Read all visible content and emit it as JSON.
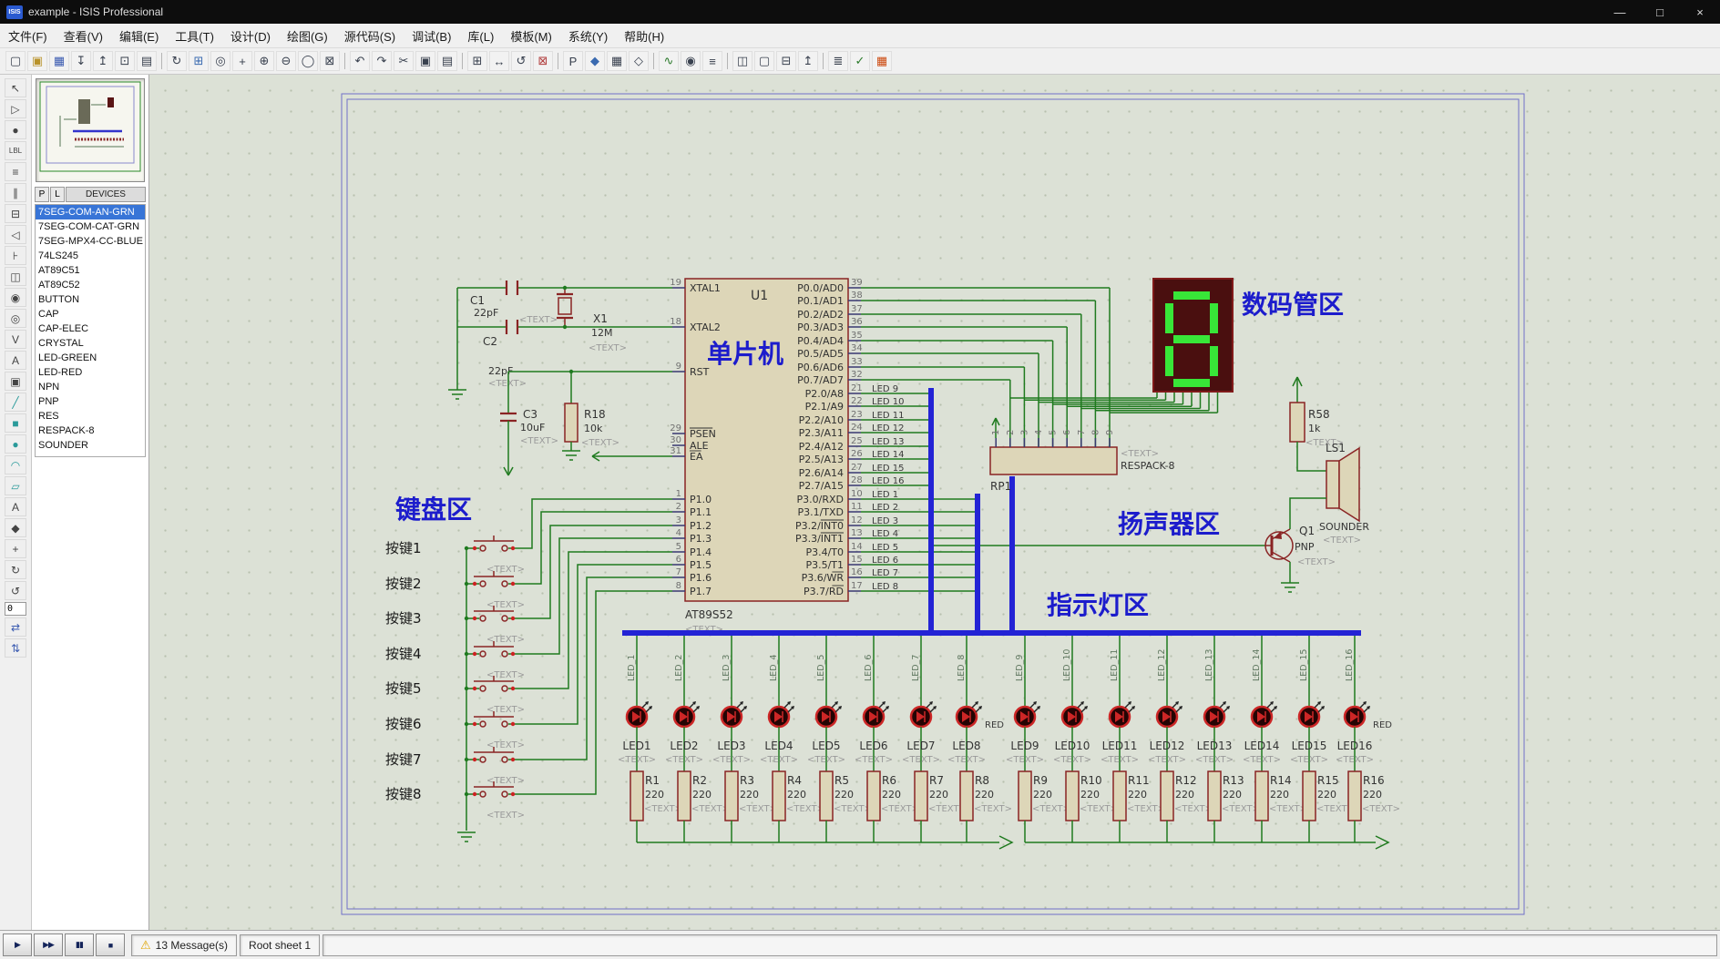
{
  "window": {
    "title": "example - ISIS Professional",
    "icon_text": "ISIS",
    "controls": {
      "minimize": "—",
      "maximize": "□",
      "close": "×"
    }
  },
  "menu_items": [
    "文件(F)",
    "查看(V)",
    "编辑(E)",
    "工具(T)",
    "设计(D)",
    "绘图(G)",
    "源代码(S)",
    "调试(B)",
    "库(L)",
    "模板(M)",
    "系统(Y)",
    "帮助(H)"
  ],
  "toolbar": [
    {
      "name": "new-file",
      "glyph": "▢"
    },
    {
      "name": "open-design",
      "glyph": "▣",
      "color": "#b8922a"
    },
    {
      "name": "save-design",
      "glyph": "▦",
      "color": "#3a5ab0"
    },
    {
      "name": "import-section",
      "glyph": "↧"
    },
    {
      "name": "export-section",
      "glyph": "↥"
    },
    {
      "name": "print-design",
      "glyph": "⊡"
    },
    {
      "name": "mark-output-area",
      "glyph": "▤"
    },
    {
      "name": "separator"
    },
    {
      "name": "redraw-display",
      "glyph": "↻"
    },
    {
      "name": "toggle-grid",
      "glyph": "⊞",
      "color": "#3a6ab0"
    },
    {
      "name": "false-origin",
      "glyph": "◎"
    },
    {
      "name": "center-at-cursor",
      "glyph": "+"
    },
    {
      "name": "zoom-in",
      "glyph": "⊕"
    },
    {
      "name": "zoom-out",
      "glyph": "⊖"
    },
    {
      "name": "zoom-all",
      "glyph": "◯"
    },
    {
      "name": "zoom-area",
      "glyph": "⊠"
    },
    {
      "name": "separator"
    },
    {
      "name": "undo",
      "glyph": "↶"
    },
    {
      "name": "redo",
      "glyph": "↷"
    },
    {
      "name": "cut",
      "glyph": "✂"
    },
    {
      "name": "copy",
      "glyph": "▣"
    },
    {
      "name": "paste",
      "glyph": "▤"
    },
    {
      "name": "separator"
    },
    {
      "name": "block-copy",
      "glyph": "⊞"
    },
    {
      "name": "block-move",
      "glyph": "↔"
    },
    {
      "name": "block-rotate",
      "glyph": "↺"
    },
    {
      "name": "block-delete",
      "glyph": "⊠",
      "color": "#b03a3a"
    },
    {
      "name": "separator"
    },
    {
      "name": "pick-device",
      "glyph": "P"
    },
    {
      "name": "make-device",
      "glyph": "◆",
      "color": "#3a6ab0"
    },
    {
      "name": "packaging-tool",
      "glyph": "▦"
    },
    {
      "name": "decompose",
      "glyph": "◇"
    },
    {
      "name": "separator"
    },
    {
      "name": "wire-autorouter",
      "glyph": "∿",
      "color": "#2a7a2a"
    },
    {
      "name": "search-tag",
      "glyph": "◉"
    },
    {
      "name": "property-assignment",
      "glyph": "≡"
    },
    {
      "name": "separator"
    },
    {
      "name": "design-explorer",
      "glyph": "◫"
    },
    {
      "name": "new-sheet",
      "glyph": "▢"
    },
    {
      "name": "remove-sheet",
      "glyph": "⊟"
    },
    {
      "name": "goto-sheet",
      "glyph": "↥"
    },
    {
      "name": "separator"
    },
    {
      "name": "bill-of-materials",
      "glyph": "≣"
    },
    {
      "name": "electrical-rule-check",
      "glyph": "✓",
      "color": "#2a7a2a"
    },
    {
      "name": "netlist-to-ares",
      "glyph": "▦",
      "color": "#cc4a10"
    }
  ],
  "left_tools": [
    {
      "name": "selection-pointer",
      "glyph": "↖"
    },
    {
      "name": "component-mode",
      "glyph": "▷"
    },
    {
      "name": "junction-dot-mode",
      "glyph": "●"
    },
    {
      "name": "wire-label-mode",
      "glyph": "LBL"
    },
    {
      "name": "text-script-mode",
      "glyph": "≡"
    },
    {
      "name": "buses-mode",
      "glyph": "∥"
    },
    {
      "name": "subcircuit-mode",
      "glyph": "⊟"
    },
    {
      "name": "terminals-mode",
      "glyph": "◁"
    },
    {
      "name": "device-pins-mode",
      "glyph": "⊦"
    },
    {
      "name": "graph-mode",
      "glyph": "◫"
    },
    {
      "name": "tape-recorder-mode",
      "glyph": "◉"
    },
    {
      "name": "generator-mode",
      "glyph": "◎"
    },
    {
      "name": "voltage-probe-mode",
      "glyph": "V"
    },
    {
      "name": "current-probe-mode",
      "glyph": "A"
    },
    {
      "name": "virtual-instruments-mode",
      "glyph": "▣"
    },
    {
      "name": "2d-line-mode",
      "glyph": "╱",
      "color": "#2a9a9a"
    },
    {
      "name": "2d-box-mode",
      "glyph": "■",
      "color": "#2a9a9a"
    },
    {
      "name": "2d-circle-mode",
      "glyph": "●",
      "color": "#2a9a9a"
    },
    {
      "name": "2d-arc-mode",
      "glyph": "◠",
      "color": "#2a9a9a"
    },
    {
      "name": "2d-path-mode",
      "glyph": "▱",
      "color": "#2a9a9a"
    },
    {
      "name": "2d-text-mode",
      "glyph": "A"
    },
    {
      "name": "2d-symbol-mode",
      "glyph": "◆"
    },
    {
      "name": "markers-mode",
      "glyph": "+"
    },
    {
      "name": "rotate-clockwise",
      "glyph": "↻"
    },
    {
      "name": "rotate-anticlockwise",
      "glyph": "↺"
    },
    {
      "name": "rotation-angle",
      "value": "0"
    },
    {
      "name": "mirror-horizontal",
      "glyph": "⇄",
      "color": "#3a5ab0"
    },
    {
      "name": "mirror-vertical",
      "glyph": "⇅",
      "color": "#3a5ab0"
    }
  ],
  "sidebar": {
    "tab_p": "P",
    "tab_l": "L",
    "header": "DEVICES",
    "selected": "7SEG-COM-AN-GRN",
    "devices": [
      "7SEG-COM-AN-GRN",
      "7SEG-COM-CAT-GRN",
      "7SEG-MPX4-CC-BLUE",
      "74LS245",
      "AT89C51",
      "AT89C52",
      "BUTTON",
      "CAP",
      "CAP-ELEC",
      "CRYSTAL",
      "LED-GREEN",
      "LED-RED",
      "NPN",
      "PNP",
      "RES",
      "RESPACK-8",
      "SOUNDER"
    ]
  },
  "statusbar": {
    "sim_buttons": [
      {
        "name": "play-button",
        "glyph": "▶"
      },
      {
        "name": "step-button",
        "glyph": "▶▶"
      },
      {
        "name": "pause-button",
        "glyph": "▮▮"
      },
      {
        "name": "stop-button",
        "glyph": "■"
      }
    ],
    "warning_icon": "⚠",
    "messages": "13 Message(s)",
    "sheet": "Root sheet 1"
  },
  "schematic": {
    "placeholder": "<TEXT>",
    "net_red": "RED",
    "seven_seg_digit": "8",
    "labels": {
      "mcu": "单片机",
      "display": "数码管区",
      "keyboard": "键盘区",
      "speaker": "扬声器区",
      "led": "指示灯区"
    },
    "mcu": {
      "ref": "U1",
      "part": "AT89S52",
      "left_pins": [
        {
          "num": "19",
          "name": "XTAL1"
        },
        {
          "num": "18",
          "name": "XTAL2"
        },
        {
          "num": "9",
          "name": "RST"
        },
        {
          "num": "29",
          "name": "PSEN",
          "bar": true
        },
        {
          "num": "30",
          "name": "ALE"
        },
        {
          "num": "31",
          "name": "EA",
          "bar": true
        },
        {
          "num": "1",
          "name": "P1.0"
        },
        {
          "num": "2",
          "name": "P1.1"
        },
        {
          "num": "3",
          "name": "P1.2"
        },
        {
          "num": "4",
          "name": "P1.3"
        },
        {
          "num": "5",
          "name": "P1.4"
        },
        {
          "num": "6",
          "name": "P1.5"
        },
        {
          "num": "7",
          "name": "P1.6"
        },
        {
          "num": "8",
          "name": "P1.7"
        }
      ],
      "p0_pins": [
        {
          "num": "39",
          "name": "P0.0/AD0"
        },
        {
          "num": "38",
          "name": "P0.1/AD1"
        },
        {
          "num": "37",
          "name": "P0.2/AD2"
        },
        {
          "num": "36",
          "name": "P0.3/AD3"
        },
        {
          "num": "35",
          "name": "P0.4/AD4"
        },
        {
          "num": "34",
          "name": "P0.5/AD5"
        },
        {
          "num": "33",
          "name": "P0.6/AD6"
        },
        {
          "num": "32",
          "name": "P0.7/AD7"
        }
      ],
      "p2_pins": [
        {
          "num": "21",
          "name": "P2.0/A8",
          "net": "LED 9"
        },
        {
          "num": "22",
          "name": "P2.1/A9",
          "net": "LED 10"
        },
        {
          "num": "23",
          "name": "P2.2/A10",
          "net": "LED 11"
        },
        {
          "num": "24",
          "name": "P2.3/A11",
          "net": "LED 12"
        },
        {
          "num": "25",
          "name": "P2.4/A12",
          "net": "LED 13"
        },
        {
          "num": "26",
          "name": "P2.5/A13",
          "net": "LED 14"
        },
        {
          "num": "27",
          "name": "P2.6/A14",
          "net": "LED 15"
        },
        {
          "num": "28",
          "name": "P2.7/A15",
          "net": "LED 16"
        }
      ],
      "p3_pins": [
        {
          "num": "10",
          "name": "P3.0/RXD",
          "net": "LED 1"
        },
        {
          "num": "11",
          "name": "P3.1/TXD",
          "net": "LED 2"
        },
        {
          "num": "12",
          "name": "P3.2/INT0",
          "net": "LED 3",
          "bar": true
        },
        {
          "num": "13",
          "name": "P3.3/INT1",
          "net": "LED 4",
          "bar": true
        },
        {
          "num": "14",
          "name": "P3.4/T0",
          "net": "LED 5"
        },
        {
          "num": "15",
          "name": "P3.5/T1",
          "net": "LED 6"
        },
        {
          "num": "16",
          "name": "P3.6/WR",
          "net": "LED 7",
          "bar": true
        },
        {
          "num": "17",
          "name": "P3.7/RD",
          "net": "LED 8",
          "bar": true
        }
      ]
    },
    "components": {
      "c1": {
        "ref": "C1",
        "value": "22pF"
      },
      "c2": {
        "ref": "C2",
        "value": "22pF"
      },
      "c3": {
        "ref": "C3",
        "value": "10uF"
      },
      "x1": {
        "ref": "X1",
        "value": "12M"
      },
      "r18": {
        "ref": "R18",
        "value": "10k"
      },
      "rp1": {
        "ref": "RP1",
        "part": "RESPACK-8",
        "pin_numbers": [
          "1",
          "2",
          "3",
          "4",
          "5",
          "6",
          "7",
          "8",
          "9"
        ]
      },
      "r58": {
        "ref": "R58",
        "value": "1k"
      },
      "ls1": {
        "ref": "LS1",
        "part": "SOUNDER"
      },
      "q1": {
        "ref": "Q1",
        "part": "PNP"
      }
    },
    "buttons": [
      "按键1",
      "按键2",
      "按键3",
      "按键4",
      "按键5",
      "按键6",
      "按键7",
      "按键8"
    ],
    "leds": [
      {
        "net": "LED_1",
        "ref": "LED1",
        "res": "R1",
        "value": "220"
      },
      {
        "net": "LED_2",
        "ref": "LED2",
        "res": "R2",
        "value": "220"
      },
      {
        "net": "LED_3",
        "ref": "LED3",
        "res": "R3",
        "value": "220"
      },
      {
        "net": "LED_4",
        "ref": "LED4",
        "res": "R4",
        "value": "220"
      },
      {
        "net": "LED_5",
        "ref": "LED5",
        "res": "R5",
        "value": "220"
      },
      {
        "net": "LED_6",
        "ref": "LED6",
        "res": "R6",
        "value": "220"
      },
      {
        "net": "LED_7",
        "ref": "LED7",
        "res": "R7",
        "value": "220"
      },
      {
        "net": "LED_8",
        "ref": "LED8",
        "res": "R8",
        "value": "220"
      },
      {
        "net": "LED_9",
        "ref": "LED9",
        "res": "R9",
        "value": "220"
      },
      {
        "net": "LED_10",
        "ref": "LED10",
        "res": "R10",
        "value": "220"
      },
      {
        "net": "LED_11",
        "ref": "LED11",
        "res": "R11",
        "value": "220"
      },
      {
        "net": "LED_12",
        "ref": "LED12",
        "res": "R12",
        "value": "220"
      },
      {
        "net": "LED_13",
        "ref": "LED13",
        "res": "R13",
        "value": "220"
      },
      {
        "net": "LED_14",
        "ref": "LED14",
        "res": "R14",
        "value": "220"
      },
      {
        "net": "LED_15",
        "ref": "LED15",
        "res": "R15",
        "value": "220"
      },
      {
        "net": "LED_16",
        "ref": "LED16",
        "res": "R16",
        "value": "220"
      }
    ]
  }
}
